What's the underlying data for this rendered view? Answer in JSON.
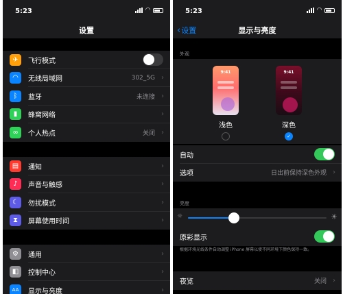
{
  "left": {
    "status": {
      "time": "5:23"
    },
    "nav": {
      "title": "设置"
    },
    "group1": [
      {
        "label": "飞行模式",
        "icon": "airplane-icon",
        "color": "#ff9f0a",
        "glyph": "✈",
        "toggle": false
      },
      {
        "label": "无线局域网",
        "icon": "wifi-icon",
        "color": "#0a84ff",
        "glyph": "◠",
        "value": "302_5G"
      },
      {
        "label": "蓝牙",
        "icon": "bluetooth-icon",
        "color": "#0a84ff",
        "glyph": "ᛒ",
        "value": "未连接"
      },
      {
        "label": "蜂窝网络",
        "icon": "cellular-icon",
        "color": "#30d158",
        "glyph": "▮",
        "value": ""
      },
      {
        "label": "个人热点",
        "icon": "hotspot-icon",
        "color": "#30d158",
        "glyph": "∞",
        "value": "关闭"
      }
    ],
    "group2": [
      {
        "label": "通知",
        "icon": "notification-icon",
        "color": "#ff3b30",
        "glyph": "▤"
      },
      {
        "label": "声音与触感",
        "icon": "sound-icon",
        "color": "#ff2d55",
        "glyph": "♪"
      },
      {
        "label": "勿扰模式",
        "icon": "moon-icon",
        "color": "#5e5ce6",
        "glyph": "☾"
      },
      {
        "label": "屏幕使用时间",
        "icon": "hourglass-icon",
        "color": "#5e5ce6",
        "glyph": "⧗"
      }
    ],
    "group3": [
      {
        "label": "通用",
        "icon": "gear-icon",
        "color": "#8e8e93",
        "glyph": "⚙"
      },
      {
        "label": "控制中心",
        "icon": "control-center-icon",
        "color": "#8e8e93",
        "glyph": "◧"
      },
      {
        "label": "显示与亮度",
        "icon": "display-icon",
        "color": "#0a84ff",
        "glyph": "AA"
      }
    ]
  },
  "right": {
    "status": {
      "time": "5:23"
    },
    "nav": {
      "back_label": "设置",
      "title": "显示与亮度"
    },
    "appearance": {
      "header": "外观",
      "light_label": "浅色",
      "dark_label": "深色",
      "light_preview_time": "9:41",
      "dark_preview_time": "9:41",
      "selected": "dark"
    },
    "auto": {
      "label": "自动",
      "on": true
    },
    "options": {
      "label": "选项",
      "value": "日出前保持深色外观"
    },
    "brightness": {
      "header": "亮度",
      "level": 0.33
    },
    "true_tone": {
      "label": "原彩显示",
      "on": true,
      "description": "根据环境光线条件自动调整 iPhone 屏幕以使不同环境下颜色保持一致。"
    },
    "night_shift": {
      "label": "夜览",
      "value": "关闭"
    }
  }
}
